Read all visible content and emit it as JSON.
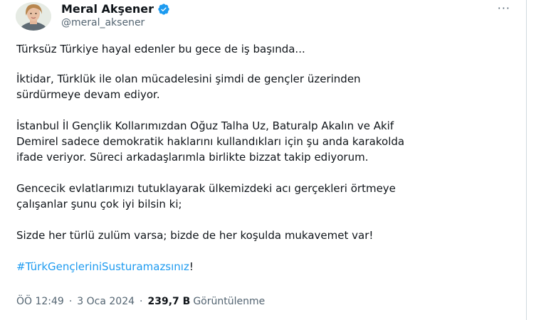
{
  "author": {
    "name": "Meral Akşener",
    "handle": "@meral_aksener",
    "verified": true,
    "badge_color": "#1d9bf0"
  },
  "menu": {
    "more_icon": "more-horizontal-icon",
    "more_glyph": "···"
  },
  "tweet": {
    "paragraphs": [
      "Türksüz Türkiye hayal edenler bu gece de iş başında...",
      "İktidar, Türklük ile olan mücadelesini şimdi de gençler üzerinden\nsürdürmeye devam ediyor.",
      "İstanbul İl Gençlik Kollarımızdan Oğuz Talha Uz, Baturalp Akalın ve Akif\nDemirel sadece demokratik haklarını kullandıkları için şu anda karakolda\nifade veriyor. Süreci arkadaşlarımla birlikte bizzat takip ediyorum.",
      "Gencecik evlatlarımızı tutuklayarak ülkemizdeki acı gerçekleri örtmeye\nçalışanlar şunu çok iyi bilsin ki;",
      "Sizde her türlü zulüm varsa; bizde de her koşulda mukavemet var!"
    ],
    "hashtag": "#TürkGençleriniSusturamazsınız",
    "hashtag_suffix": "!",
    "hashtag_color": "#1d9bf0"
  },
  "meta": {
    "time": "ÖÖ 12:49",
    "separator": "·",
    "date": "3 Oca 2024",
    "views_count": "239,7 B",
    "views_label": "Görüntülenme"
  }
}
